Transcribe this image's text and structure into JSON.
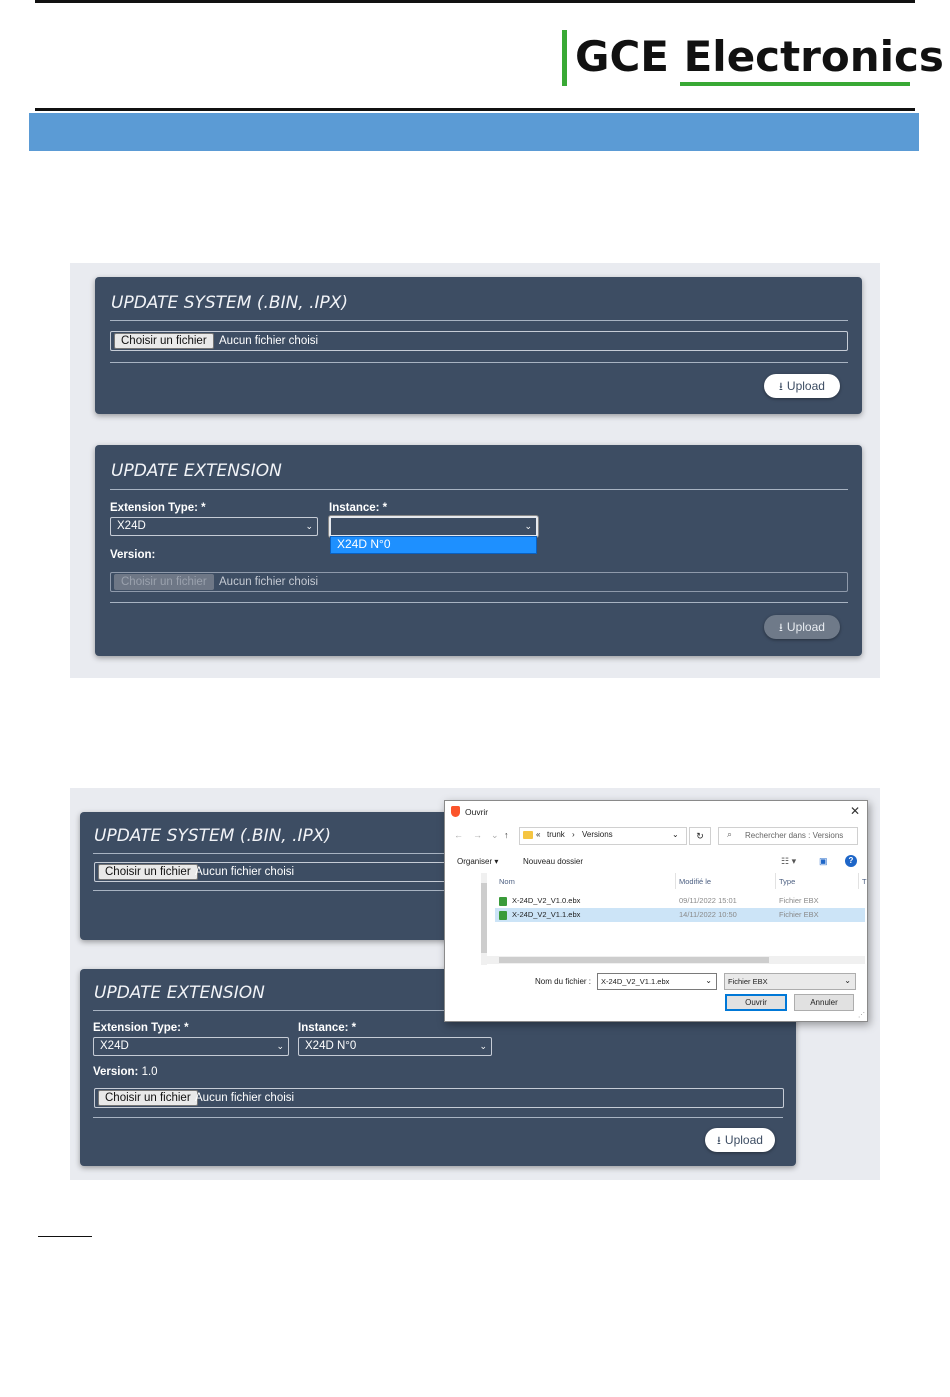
{
  "header": {
    "logo_text": "GCE Electronics"
  },
  "screenshot1": {
    "system_card": {
      "title": "UPDATE SYSTEM (.BIN, .IPX)",
      "file_button": "Choisir un fichier",
      "file_status": "Aucun fichier choisi",
      "upload_label": "Upload"
    },
    "extension_card": {
      "title": "UPDATE EXTENSION",
      "ext_type_label": "Extension Type: *",
      "ext_type_value": "X24D",
      "instance_label": "Instance: *",
      "instance_value": "",
      "dropdown_option": "X24D N°0",
      "version_label": "Version:",
      "file_button": "Choisir un fichier",
      "file_status": "Aucun fichier choisi",
      "upload_label": "Upload"
    }
  },
  "screenshot2": {
    "system_card": {
      "title": "UPDATE SYSTEM (.BIN, .IPX)",
      "file_button": "Choisir un fichier",
      "file_status": "Aucun fichier choisi"
    },
    "extension_card": {
      "title": "UPDATE EXTENSION",
      "ext_type_label": "Extension Type: *",
      "ext_type_value": "X24D",
      "instance_label": "Instance: *",
      "instance_value": "X24D N°0",
      "version_label": "Version:",
      "version_value": "1.0",
      "file_button": "Choisir un fichier",
      "file_status": "Aucun fichier choisi",
      "upload_label": "Upload"
    },
    "dialog": {
      "title": "Ouvrir",
      "path_prefix": "«",
      "path_folder1": "trunk",
      "path_sep": "›",
      "path_folder2": "Versions",
      "search_placeholder": "Rechercher dans : Versions",
      "organize": "Organiser ▾",
      "new_folder": "Nouveau dossier",
      "columns": [
        "Nom",
        "Modifié le",
        "Type",
        "T"
      ],
      "files": [
        {
          "name": "X-24D_V2_V1.0.ebx",
          "modified": "09/11/2022 15:01",
          "type": "Fichier EBX"
        },
        {
          "name": "X-24D_V2_V1.1.ebx",
          "modified": "14/11/2022 10:50",
          "type": "Fichier EBX"
        }
      ],
      "filename_label": "Nom du fichier :",
      "filename_value": "X-24D_V2_V1.1.ebx",
      "filetype_value": "Fichier EBX",
      "open_button": "Ouvrir",
      "cancel_button": "Annuler"
    }
  },
  "colors": {
    "card_bg": "#3d4d63",
    "band_blue": "#5b9bd5",
    "logo_green": "#39a935",
    "selection_blue": "#1e90ff"
  }
}
